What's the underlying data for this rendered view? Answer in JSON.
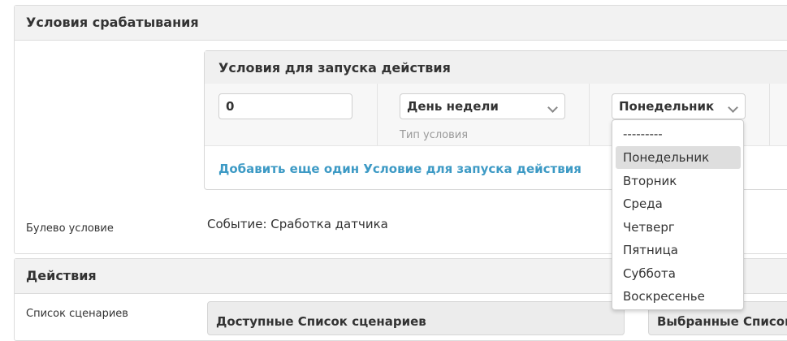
{
  "trigger_section": {
    "title": "Условия срабатывания",
    "inline": {
      "title": "Условия для запуска действия",
      "row": {
        "value_input": "0",
        "condition_type": {
          "selected": "День недели",
          "help_text": "Тип условия"
        },
        "day_select": {
          "selected": "Понедельник"
        }
      },
      "add_link": "Добавить еще один Условие для запуска действия"
    },
    "bool_row": {
      "label": "Булево условие",
      "value": "Событие: Сработка датчика"
    }
  },
  "actions_section": {
    "title": "Действия",
    "scenarios_row": {
      "label": "Список сценариев",
      "available_title": "Доступные Список сценариев",
      "chosen_title": "Выбранные Список сценариев"
    }
  },
  "day_dropdown": {
    "options": [
      "---------",
      "Понедельник",
      "Вторник",
      "Среда",
      "Четверг",
      "Пятница",
      "Суббота",
      "Воскресенье"
    ],
    "highlighted": "Понедельник"
  },
  "colors": {
    "link": "#3d9ac5",
    "header_bg": "#f2f2f2",
    "highlight": "#dedede",
    "help_text": "#999999"
  }
}
